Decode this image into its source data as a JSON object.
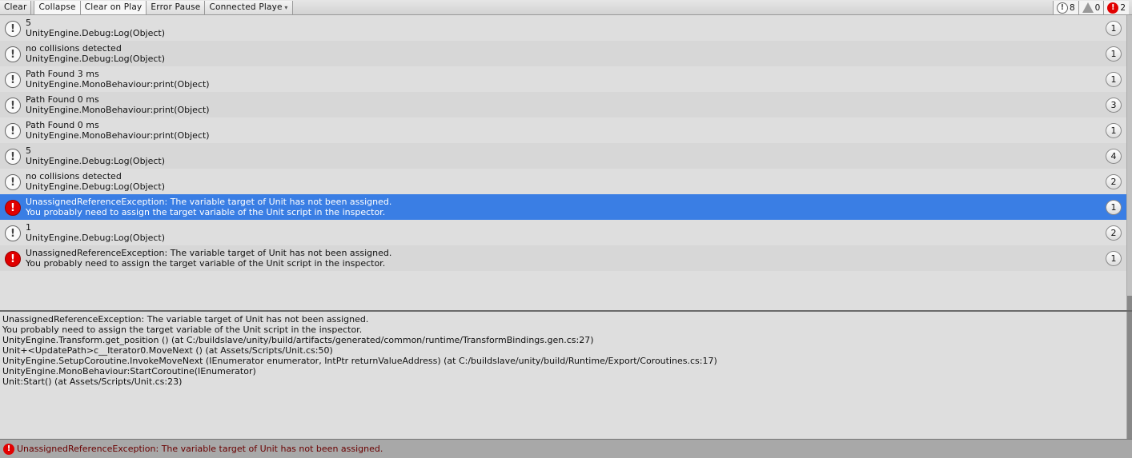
{
  "toolbar": {
    "clear": "Clear",
    "collapse": "Collapse",
    "clear_on_play": "Clear on Play",
    "error_pause": "Error Pause",
    "connected_player": "Connected Playe",
    "log_count": "8",
    "warning_count": "0",
    "error_count": "2"
  },
  "colors": {
    "selected": "#3a7ee4",
    "error": "#e00000",
    "status_text": "#6a0000"
  },
  "entries": [
    {
      "type": "info",
      "line1": "5",
      "line2": "UnityEngine.Debug:Log(Object)",
      "count": "1"
    },
    {
      "type": "info",
      "line1": "no collisions detected",
      "line2": "UnityEngine.Debug:Log(Object)",
      "count": "1"
    },
    {
      "type": "info",
      "line1": "Path Found 3 ms",
      "line2": "UnityEngine.MonoBehaviour:print(Object)",
      "count": "1"
    },
    {
      "type": "info",
      "line1": "Path Found 0 ms",
      "line2": "UnityEngine.MonoBehaviour:print(Object)",
      "count": "3"
    },
    {
      "type": "info",
      "line1": "Path Found 0 ms",
      "line2": "UnityEngine.MonoBehaviour:print(Object)",
      "count": "1"
    },
    {
      "type": "info",
      "line1": "5",
      "line2": "UnityEngine.Debug:Log(Object)",
      "count": "4"
    },
    {
      "type": "info",
      "line1": "no collisions detected",
      "line2": "UnityEngine.Debug:Log(Object)",
      "count": "2"
    },
    {
      "type": "error",
      "selected": true,
      "line1": "UnassignedReferenceException: The variable target of Unit has not been assigned.",
      "line2": "You probably need to assign the target variable of the Unit script in the inspector.",
      "count": "1"
    },
    {
      "type": "info",
      "line1": "1",
      "line2": "UnityEngine.Debug:Log(Object)",
      "count": "2"
    },
    {
      "type": "error",
      "line1": "UnassignedReferenceException: The variable target of Unit has not been assigned.",
      "line2": "You probably need to assign the target variable of the Unit script in the inspector.",
      "count": "1"
    }
  ],
  "detail": [
    "UnassignedReferenceException: The variable target of Unit has not been assigned.",
    "You probably need to assign the target variable of the Unit script in the inspector.",
    "UnityEngine.Transform.get_position () (at C:/buildslave/unity/build/artifacts/generated/common/runtime/TransformBindings.gen.cs:27)",
    "Unit+<UpdatePath>c__Iterator0.MoveNext () (at Assets/Scripts/Unit.cs:50)",
    "UnityEngine.SetupCoroutine.InvokeMoveNext (IEnumerator enumerator, IntPtr returnValueAddress) (at C:/buildslave/unity/build/Runtime/Export/Coroutines.cs:17)",
    "UnityEngine.MonoBehaviour:StartCoroutine(IEnumerator)",
    "Unit:Start() (at Assets/Scripts/Unit.cs:23)"
  ],
  "status": {
    "text": "UnassignedReferenceException: The variable target of Unit has not been assigned."
  }
}
